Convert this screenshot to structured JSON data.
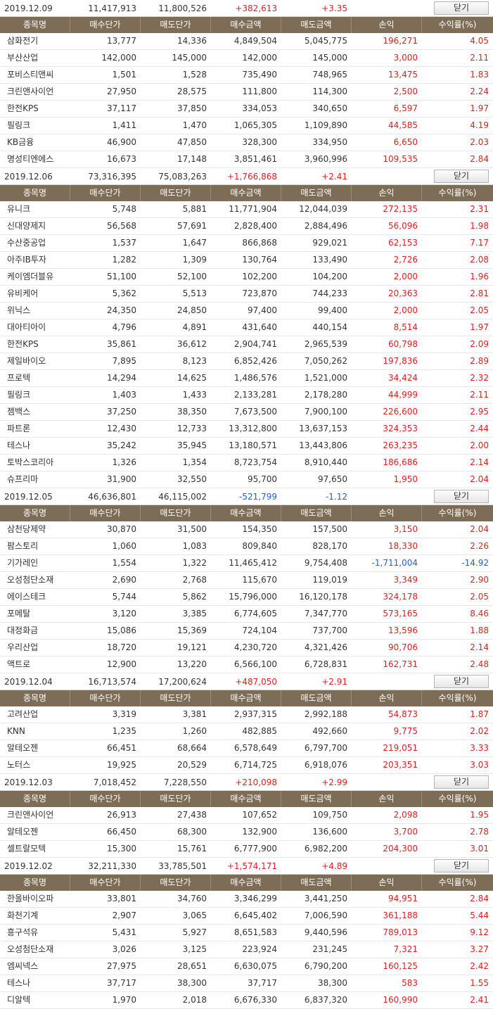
{
  "headers": [
    "종목명",
    "매수단가",
    "매도단가",
    "매수금액",
    "매도금액",
    "손익",
    "수익률(%)"
  ],
  "close_label": "닫기",
  "days": [
    {
      "date": "2019.12.09",
      "buy_total": "11,417,913",
      "sell_total": "11,800,526",
      "pnl": "+382,613",
      "rate": "+3.35",
      "sign": "pos",
      "rows": [
        [
          "삼화전기",
          "13,777",
          "14,336",
          "4,849,504",
          "5,045,775",
          "196,271",
          "4.05",
          "pos"
        ],
        [
          "부산산업",
          "142,000",
          "145,000",
          "142,000",
          "145,000",
          "3,000",
          "2.11",
          "pos"
        ],
        [
          "포비스티앤씨",
          "1,501",
          "1,528",
          "735,490",
          "748,965",
          "13,475",
          "1.83",
          "pos"
        ],
        [
          "크린앤사이언",
          "27,950",
          "28,575",
          "111,800",
          "114,300",
          "2,500",
          "2.24",
          "pos"
        ],
        [
          "한전KPS",
          "37,117",
          "37,850",
          "334,053",
          "340,650",
          "6,597",
          "1.97",
          "pos"
        ],
        [
          "필링크",
          "1,411",
          "1,470",
          "1,065,305",
          "1,109,890",
          "44,585",
          "4.19",
          "pos"
        ],
        [
          "KB금융",
          "46,900",
          "47,850",
          "328,300",
          "334,950",
          "6,650",
          "2.03",
          "pos"
        ],
        [
          "명성티엔에스",
          "16,673",
          "17,148",
          "3,851,461",
          "3,960,996",
          "109,535",
          "2.84",
          "pos"
        ]
      ]
    },
    {
      "date": "2019.12.06",
      "buy_total": "73,316,395",
      "sell_total": "75,083,263",
      "pnl": "+1,766,868",
      "rate": "+2.41",
      "sign": "pos",
      "rows": [
        [
          "유니크",
          "5,748",
          "5,881",
          "11,771,904",
          "12,044,039",
          "272,135",
          "2.31",
          "pos"
        ],
        [
          "신대양제지",
          "56,568",
          "57,691",
          "2,828,400",
          "2,884,496",
          "56,096",
          "1.98",
          "pos"
        ],
        [
          "수산중공업",
          "1,537",
          "1,647",
          "866,868",
          "929,021",
          "62,153",
          "7.17",
          "pos"
        ],
        [
          "아주IB투자",
          "1,282",
          "1,309",
          "130,764",
          "133,490",
          "2,726",
          "2.08",
          "pos"
        ],
        [
          "케이엠더블유",
          "51,100",
          "52,100",
          "102,200",
          "104,200",
          "2,000",
          "1.96",
          "pos"
        ],
        [
          "유비케어",
          "5,362",
          "5,513",
          "723,870",
          "744,233",
          "20,363",
          "2.81",
          "pos"
        ],
        [
          "위닉스",
          "24,350",
          "24,850",
          "97,400",
          "99,400",
          "2,000",
          "2.05",
          "pos"
        ],
        [
          "대아티아이",
          "4,796",
          "4,891",
          "431,640",
          "440,154",
          "8,514",
          "1.97",
          "pos"
        ],
        [
          "한전KPS",
          "35,861",
          "36,612",
          "2,904,741",
          "2,965,539",
          "60,798",
          "2.09",
          "pos"
        ],
        [
          "제일바이오",
          "7,895",
          "8,123",
          "6,852,426",
          "7,050,262",
          "197,836",
          "2.89",
          "pos"
        ],
        [
          "프로텍",
          "14,294",
          "14,625",
          "1,486,576",
          "1,521,000",
          "34,424",
          "2.32",
          "pos"
        ],
        [
          "필링크",
          "1,403",
          "1,433",
          "2,133,281",
          "2,178,280",
          "44,999",
          "2.11",
          "pos"
        ],
        [
          "젬백스",
          "37,250",
          "38,350",
          "7,673,500",
          "7,900,100",
          "226,600",
          "2.95",
          "pos"
        ],
        [
          "파트론",
          "12,430",
          "12,733",
          "13,312,800",
          "13,637,153",
          "324,353",
          "2.44",
          "pos"
        ],
        [
          "테스나",
          "35,242",
          "35,945",
          "13,180,571",
          "13,443,806",
          "263,235",
          "2.00",
          "pos"
        ],
        [
          "토박스코리아",
          "1,326",
          "1,354",
          "8,723,754",
          "8,910,440",
          "186,686",
          "2.14",
          "pos"
        ],
        [
          "슈프리마",
          "31,900",
          "32,550",
          "95,700",
          "97,650",
          "1,950",
          "2.04",
          "pos"
        ]
      ]
    },
    {
      "date": "2019.12.05",
      "buy_total": "46,636,801",
      "sell_total": "46,115,002",
      "pnl": "-521,799",
      "rate": "-1.12",
      "sign": "neg",
      "rows": [
        [
          "삼천당제약",
          "30,870",
          "31,500",
          "154,350",
          "157,500",
          "3,150",
          "2.04",
          "pos"
        ],
        [
          "팜스토리",
          "1,060",
          "1,083",
          "809,840",
          "828,170",
          "18,330",
          "2.26",
          "pos"
        ],
        [
          "기가레인",
          "1,554",
          "1,322",
          "11,465,412",
          "9,754,408",
          "-1,711,004",
          "-14.92",
          "neg"
        ],
        [
          "오성첨단소재",
          "2,690",
          "2,768",
          "115,670",
          "119,019",
          "3,349",
          "2.90",
          "pos"
        ],
        [
          "에이스테크",
          "5,744",
          "5,862",
          "15,796,000",
          "16,120,178",
          "324,178",
          "2.05",
          "pos"
        ],
        [
          "포메탈",
          "3,120",
          "3,385",
          "6,774,605",
          "7,347,770",
          "573,165",
          "8.46",
          "pos"
        ],
        [
          "대정화금",
          "15,086",
          "15,369",
          "724,104",
          "737,700",
          "13,596",
          "1.88",
          "pos"
        ],
        [
          "우리산업",
          "18,720",
          "19,121",
          "4,230,720",
          "4,321,426",
          "90,706",
          "2.14",
          "pos"
        ],
        [
          "액트로",
          "12,900",
          "13,220",
          "6,566,100",
          "6,728,831",
          "162,731",
          "2.48",
          "pos"
        ]
      ]
    },
    {
      "date": "2019.12.04",
      "buy_total": "16,713,574",
      "sell_total": "17,200,624",
      "pnl": "+487,050",
      "rate": "+2.91",
      "sign": "pos",
      "rows": [
        [
          "고려산업",
          "3,319",
          "3,381",
          "2,937,315",
          "2,992,188",
          "54,873",
          "1.87",
          "pos"
        ],
        [
          "KNN",
          "1,235",
          "1,260",
          "482,885",
          "492,660",
          "9,775",
          "2.02",
          "pos"
        ],
        [
          "알테오젠",
          "66,451",
          "68,664",
          "6,578,649",
          "6,797,700",
          "219,051",
          "3.33",
          "pos"
        ],
        [
          "노터스",
          "19,925",
          "20,529",
          "6,714,725",
          "6,918,076",
          "203,351",
          "3.03",
          "pos"
        ]
      ]
    },
    {
      "date": "2019.12.03",
      "buy_total": "7,018,452",
      "sell_total": "7,228,550",
      "pnl": "+210,098",
      "rate": "+2.99",
      "sign": "pos",
      "rows": [
        [
          "크린앤사이언",
          "26,913",
          "27,438",
          "107,652",
          "109,750",
          "2,098",
          "1.95",
          "pos"
        ],
        [
          "알테오젠",
          "66,450",
          "68,300",
          "132,900",
          "136,600",
          "3,700",
          "2.78",
          "pos"
        ],
        [
          "셀트랄모텍",
          "15,300",
          "15,761",
          "6,777,900",
          "6,982,200",
          "204,300",
          "3.01",
          "pos"
        ]
      ]
    },
    {
      "date": "2019.12.02",
      "buy_total": "32,211,330",
      "sell_total": "33,785,501",
      "pnl": "+1,574,171",
      "rate": "+4.89",
      "sign": "pos",
      "rows": [
        [
          "한올바이오파",
          "33,801",
          "34,760",
          "3,346,299",
          "3,441,250",
          "94,951",
          "2.84",
          "pos"
        ],
        [
          "화천기계",
          "2,907",
          "3,065",
          "6,645,402",
          "7,006,590",
          "361,188",
          "5.44",
          "pos"
        ],
        [
          "흥구석유",
          "5,431",
          "5,927",
          "8,651,583",
          "9,440,596",
          "789,013",
          "9.12",
          "pos"
        ],
        [
          "오성첨단소재",
          "3,026",
          "3,125",
          "223,924",
          "231,245",
          "7,321",
          "3.27",
          "pos"
        ],
        [
          "엠씨넥스",
          "27,975",
          "28,651",
          "6,630,075",
          "6,790,200",
          "160,125",
          "2.42",
          "pos"
        ],
        [
          "테스나",
          "37,717",
          "38,300",
          "37,717",
          "38,300",
          "583",
          "1.55",
          "pos"
        ],
        [
          "디알텍",
          "1,970",
          "2,018",
          "6,676,330",
          "6,837,320",
          "160,990",
          "2.41",
          "pos"
        ]
      ]
    }
  ]
}
